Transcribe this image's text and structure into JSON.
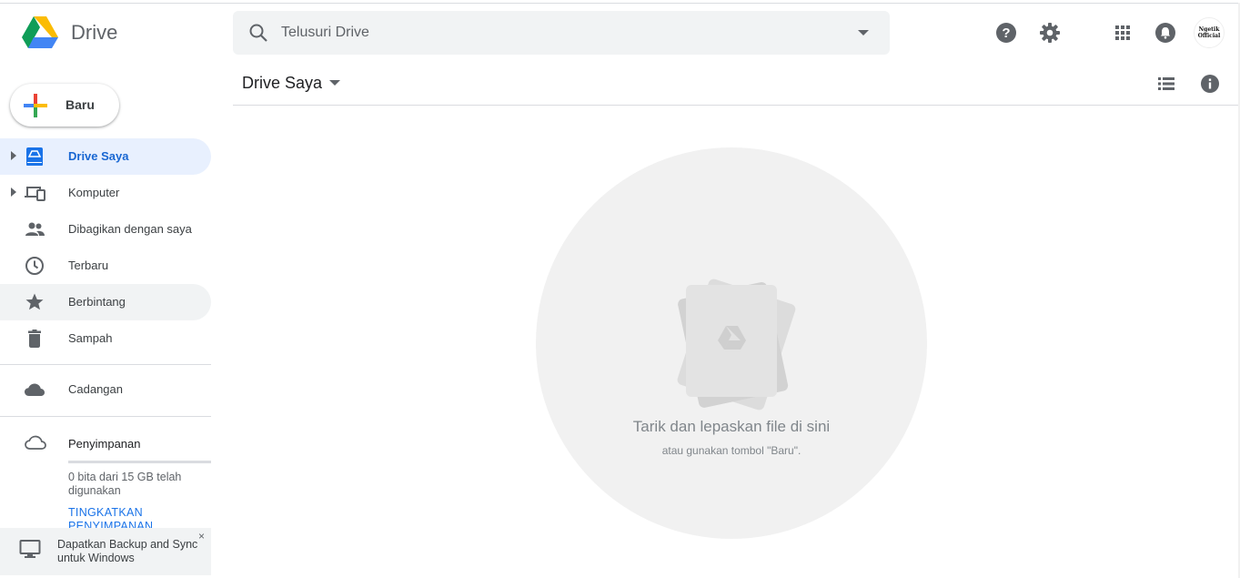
{
  "app": {
    "name": "Drive"
  },
  "search": {
    "placeholder": "Telusuri Drive"
  },
  "header": {
    "avatar_text": "Ngetik Official",
    "icons": [
      "help-icon",
      "settings-icon",
      "apps-grid-icon",
      "notifications-icon"
    ]
  },
  "new_button": {
    "label": "Baru"
  },
  "sidebar": {
    "items": [
      {
        "label": "Drive Saya",
        "icon": "my-drive-icon",
        "active": true
      },
      {
        "label": "Komputer",
        "icon": "computers-icon"
      },
      {
        "label": "Dibagikan dengan saya",
        "icon": "shared-icon"
      },
      {
        "label": "Terbaru",
        "icon": "recent-icon"
      },
      {
        "label": "Berbintang",
        "icon": "star-icon"
      },
      {
        "label": "Sampah",
        "icon": "trash-icon"
      }
    ],
    "backup": {
      "label": "Cadangan",
      "icon": "cloud-icon"
    },
    "storage": {
      "label": "Penyimpanan",
      "usage": "0 bita dari 15 GB telah digunakan",
      "used_fraction": 0,
      "upgrade": "TINGKATKAN PENYIMPANAN"
    },
    "promo": {
      "text": "Dapatkan Backup and Sync untuk Windows",
      "close": "×"
    }
  },
  "main": {
    "title": "Drive Saya",
    "empty_title": "Tarik dan lepaskan file di sini",
    "empty_subtitle": "atau gunakan tombol \"Baru\"."
  },
  "colors": {
    "accent": "#1a73e8",
    "active_bg": "#e8f0fe",
    "icon": "#5f6368"
  }
}
